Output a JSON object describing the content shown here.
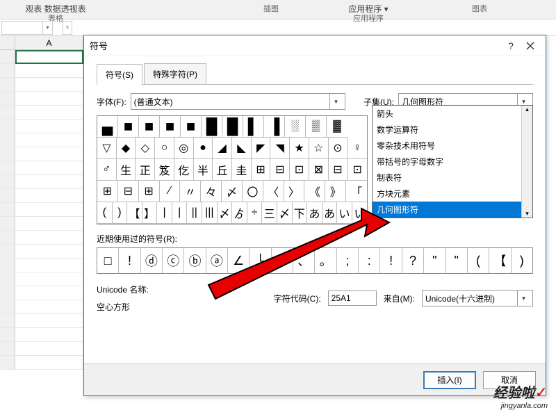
{
  "ribbon": {
    "g1a": "观表 数据透视表",
    "g1b": "表格",
    "g2": "插图",
    "g3a": "应用程序 ▾",
    "g3b": "应用程序",
    "g4": "图表"
  },
  "namebox": "",
  "colA": "A",
  "dlg": {
    "title": "符号",
    "help": "?",
    "tab1": "符号(S)",
    "tab2": "特殊字符(P)",
    "font_label": "字体(F):",
    "font_value": "(普通文本)",
    "subset_label": "子集(U):",
    "subset_value": "几何图形符",
    "dropdown": {
      "items": [
        "箭头",
        "数学运算符",
        "零杂技术用符号",
        "带括号的字母数字",
        "制表符",
        "方块元素",
        "几何图形符"
      ],
      "highlight_index": 6
    },
    "grid": [
      [
        "▄",
        "■",
        "■",
        "■",
        "■",
        "█",
        "█",
        "▌",
        "▐",
        "░",
        "▒",
        "▓"
      ],
      [
        "▽",
        "◆",
        "◇",
        "○",
        "◎",
        "●",
        "◢",
        "◣",
        "◤",
        "◥",
        "★",
        "☆",
        "⊙",
        "♀"
      ],
      [
        "♂",
        "生",
        "正",
        "笈",
        "仡",
        "半",
        "丘",
        "圭",
        "⊞",
        "⊟",
        "⊡",
        "⊠",
        "⊟",
        "⊡"
      ],
      [
        "⊞",
        "⊟",
        "⊞",
        "⁄",
        "〃",
        "々",
        "〆",
        "〇",
        "〈",
        "〉",
        "《",
        "》",
        "「"
      ],
      [
        "(",
        ")",
        "【",
        "】",
        "|",
        "|",
        "||",
        "|||",
        "〆",
        "ゟ",
        "÷",
        "三",
        "〆",
        "下",
        "あ",
        "あ",
        "い",
        "い"
      ]
    ],
    "recent_label": "近期使用过的符号(R):",
    "recent": [
      "□",
      "!",
      "ⓓ",
      "ⓒ",
      "ⓑ",
      "ⓐ",
      "∠",
      "└",
      "，",
      "、",
      "。",
      ";",
      ":",
      "!",
      "?",
      "\"",
      "\"",
      "(",
      "【",
      ")"
    ],
    "unicode_name_label": "Unicode 名称:",
    "unicode_name": "空心方形",
    "code_label": "字符代码(C):",
    "code_value": "25A1",
    "from_label": "来自(M):",
    "from_value": "Unicode(十六进制)",
    "insert": "插入(I)",
    "cancel": "取消"
  },
  "watermark": {
    "brand": "经验啦",
    "url": "jingyanla.com"
  }
}
